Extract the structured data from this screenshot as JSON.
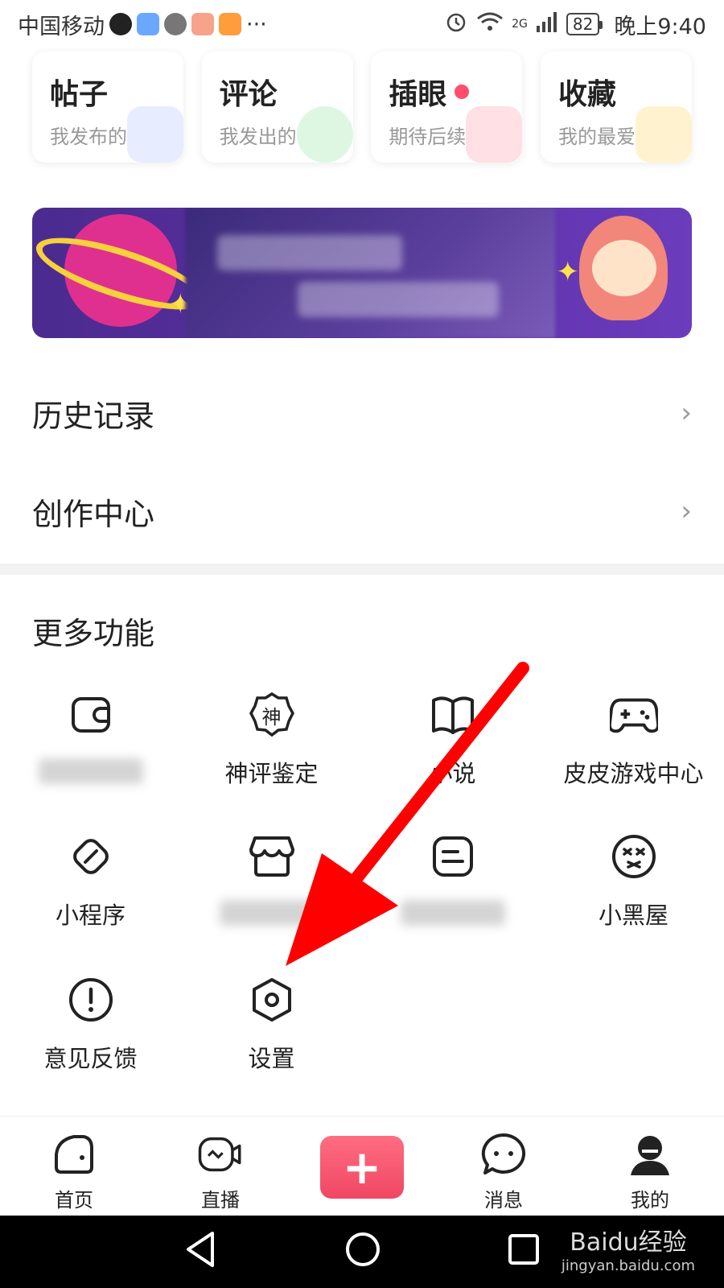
{
  "status_bar": {
    "carrier": "中国移动",
    "more": "···",
    "network": "2G",
    "battery": "82",
    "time": "晚上9:40"
  },
  "cards": [
    {
      "title": "帖子",
      "subtitle": "我发布的",
      "deco_color": "#e8ecff"
    },
    {
      "title": "评论",
      "subtitle": "我发出的",
      "deco_color": "#ddf7e3"
    },
    {
      "title": "插眼",
      "subtitle": "期待后续",
      "deco_color": "#ffe0e4"
    },
    {
      "title": "收藏",
      "subtitle": "我的最爱",
      "deco_color": "#fff3cf"
    }
  ],
  "menu": {
    "history": "历史记录",
    "creator": "创作中心",
    "chevron": "›"
  },
  "more_section": {
    "title": "更多功能",
    "items": [
      {
        "label": "",
        "icon": "wallet-icon"
      },
      {
        "label": "神评鉴定",
        "icon": "shen-badge-icon",
        "badge": "神"
      },
      {
        "label": "小说",
        "icon": "book-icon"
      },
      {
        "label": "皮皮游戏中心",
        "icon": "gamepad-icon"
      },
      {
        "label": "小程序",
        "icon": "link-icon"
      },
      {
        "label": "",
        "icon": "shop-icon"
      },
      {
        "label": "",
        "icon": "note-icon"
      },
      {
        "label": "小黑屋",
        "icon": "dizzy-face-icon"
      },
      {
        "label": "意见反馈",
        "icon": "exclamation-icon"
      },
      {
        "label": "设置",
        "icon": "settings-hex-icon"
      }
    ]
  },
  "bottom_nav": {
    "home": "首页",
    "live": "直播",
    "post": "+",
    "messages": "消息",
    "mine": "我的"
  },
  "watermark": {
    "brand": "Baidu经验",
    "url": "jingyan.baidu.com"
  },
  "colors": {
    "accent": "#f04763",
    "annotation_arrow": "#ff0000"
  }
}
